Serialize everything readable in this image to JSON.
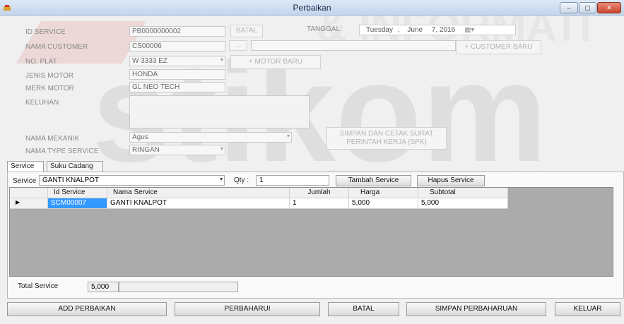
{
  "window": {
    "title": "Perbaikan",
    "controls": {
      "minimize": "‒",
      "maximize": "▢",
      "close": "✕"
    }
  },
  "form": {
    "id_service": {
      "label": "ID SERVICE",
      "value": "PB0000000002",
      "batal": "BATAL"
    },
    "tanggal": {
      "label": "TANGGAL",
      "day": "Tuesday",
      "sep": ",",
      "month": "June",
      "date": "7, 2016",
      "cal": "▦▾"
    },
    "nama_customer": {
      "label": "NAMA CUSTOMER",
      "value": "CS00006",
      "dots": "...",
      "name": "",
      "add_btn": "+ CUSTOMER BARU"
    },
    "no_plat": {
      "label": "NO. PLAT",
      "value": "W 3333 EZ",
      "add_btn": "+ MOTOR BARU"
    },
    "jenis_motor": {
      "label": "JENIS MOTOR",
      "value": "HONDA"
    },
    "merk_motor": {
      "label": "MERK MOTOR",
      "value": "GL NEO TECH"
    },
    "keluhan": {
      "label": "KELUHAN",
      "value": ""
    },
    "nama_mekanik": {
      "label": "NAMA MEKANIK",
      "value": "Agus"
    },
    "nama_type_service": {
      "label": "NAMA TYPE SERVICE",
      "value": "RINGAN"
    },
    "simpan_cetak": "SIMPAN DAN CETAK SURAT PERINTAH KERJA (SPK)"
  },
  "tabs": [
    "Service",
    "Suku Cadang"
  ],
  "service_panel": {
    "service_label": "Service :",
    "service_value": "GANTI KNALPOT",
    "qty_label": "Qty :",
    "qty_value": "1",
    "tambah_btn": "Tambah Service",
    "hapus_btn": "Hapus Service",
    "table": {
      "columns": [
        "Id Service",
        "Nama Service",
        "Jumlah",
        "Harga",
        "Subtotal"
      ],
      "rows": [
        {
          "marker": "▶",
          "id": "SCM00007",
          "nama": "GANTI KNALPOT",
          "jumlah": "1",
          "harga": "5,000",
          "subtotal": "5,000"
        }
      ]
    },
    "total_label": "Total Service",
    "total_value": "5,000",
    "total_extra": ""
  },
  "buttons": {
    "add": "ADD PERBAIKAN",
    "perbaharui": "PERBAHARUI",
    "batal": "BATAL",
    "simpan": "SIMPAN PERBAHARUAN",
    "keluar": "KELUAR"
  },
  "watermark": {
    "main": "stikom",
    "top": "& INFORMATI",
    "bottom": "SURABAYA"
  },
  "colors": {
    "selection": "#3399ff",
    "grid_bg": "#ababab",
    "watermark_red": "#e8b4b4"
  }
}
